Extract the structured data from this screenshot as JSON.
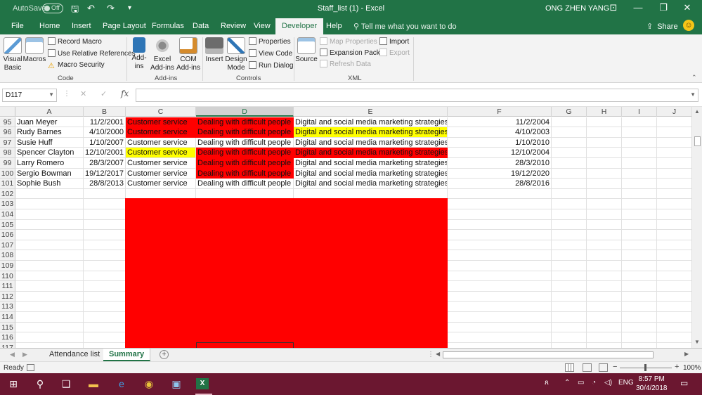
{
  "titlebar": {
    "autosave_label": "AutoSave",
    "autosave_state": "Off",
    "title": "Staff_list (1)  -  Excel",
    "user": "ONG ZHEN YANG"
  },
  "tabs": [
    "File",
    "Home",
    "Insert",
    "Page Layout",
    "Formulas",
    "Data",
    "Review",
    "View",
    "Developer",
    "Help"
  ],
  "active_tab": "Developer",
  "tell_me": "Tell me what you want to do",
  "share": "Share",
  "ribbon": {
    "code": {
      "label": "Code",
      "visual_basic": "Visual Basic",
      "macros": "Macros",
      "record_macro": "Record Macro",
      "relative_refs": "Use Relative References",
      "macro_security": "Macro Security"
    },
    "addins": {
      "label": "Add-ins",
      "addins": "Add-ins",
      "excel_addins": "Excel Add-ins",
      "com_addins": "COM Add-ins"
    },
    "controls": {
      "label": "Controls",
      "insert": "Insert",
      "design_mode": "Design Mode",
      "properties": "Properties",
      "view_code": "View Code",
      "run_dialog": "Run Dialog"
    },
    "xml": {
      "label": "XML",
      "source": "Source",
      "map_properties": "Map Properties",
      "expansion_packs": "Expansion Packs",
      "refresh_data": "Refresh Data",
      "import": "Import",
      "export": "Export"
    }
  },
  "formula_bar": {
    "name_box": "D117",
    "value": ""
  },
  "columns": [
    "A",
    "B",
    "C",
    "D",
    "E",
    "F",
    "G",
    "H",
    "I",
    "J"
  ],
  "rows": [
    {
      "num": "95",
      "a": "Juan Meyer",
      "b": "11/2/2001",
      "c": "Customer service",
      "d": "Dealing with difficult people",
      "e": "Digital and social media marketing strategies",
      "f": "11/2/2004"
    },
    {
      "num": "96",
      "a": "Rudy Barnes",
      "b": "4/10/2000",
      "c": "Customer service",
      "d": "Dealing with difficult people",
      "e": "Digital and social media marketing strategies",
      "f": "4/10/2003"
    },
    {
      "num": "97",
      "a": "Susie Huff",
      "b": "1/10/2007",
      "c": "Customer service",
      "d": "Dealing with difficult people",
      "e": "Digital and social media marketing strategies",
      "f": "1/10/2010"
    },
    {
      "num": "98",
      "a": "Spencer Clayton",
      "b": "12/10/2001",
      "c": "Customer service",
      "d": "Dealing with difficult people",
      "e": "Digital and social media marketing strategies",
      "f": "12/10/2004"
    },
    {
      "num": "99",
      "a": "Larry Romero",
      "b": "28/3/2007",
      "c": "Customer service",
      "d": "Dealing with difficult people",
      "e": "Digital and social media marketing strategies",
      "f": "28/3/2010"
    },
    {
      "num": "100",
      "a": "Sergio Bowman",
      "b": "19/12/2017",
      "c": "Customer service",
      "d": "Dealing with difficult people",
      "e": "Digital and social media marketing strategies",
      "f": "19/12/2020"
    },
    {
      "num": "101",
      "a": "Sophie Bush",
      "b": "28/8/2013",
      "c": "Customer service",
      "d": "Dealing with difficult people",
      "e": "Digital and social media marketing strategies",
      "f": "28/8/2016"
    }
  ],
  "cell_fills": {
    "95": {
      "c": "red",
      "d": "red",
      "e": ""
    },
    "96": {
      "c": "red",
      "d": "red",
      "e": "yellow"
    },
    "97": {
      "c": "",
      "d": "",
      "e": ""
    },
    "98": {
      "c": "yellow",
      "d": "red",
      "e": "red"
    },
    "99": {
      "c": "",
      "d": "red",
      "e": ""
    },
    "100": {
      "c": "",
      "d": "red",
      "e": ""
    },
    "101": {
      "c": "",
      "d": "",
      "e": ""
    }
  },
  "empty_rows": [
    "102",
    "103",
    "104",
    "105",
    "106",
    "107",
    "108",
    "109",
    "110",
    "111",
    "112",
    "113",
    "114",
    "115",
    "116",
    "117"
  ],
  "sheets": [
    "Attendance list",
    "Summary"
  ],
  "active_sheet": "Summary",
  "status": {
    "ready": "Ready",
    "zoom": "100%"
  },
  "taskbar": {
    "language": "ENG",
    "time": "8:57 PM",
    "date": "30/4/2018"
  },
  "colors": {
    "excel_green": "#217346",
    "fill_red": "#ff0000",
    "fill_yellow": "#ffff00",
    "taskbar": "#6b1730"
  }
}
